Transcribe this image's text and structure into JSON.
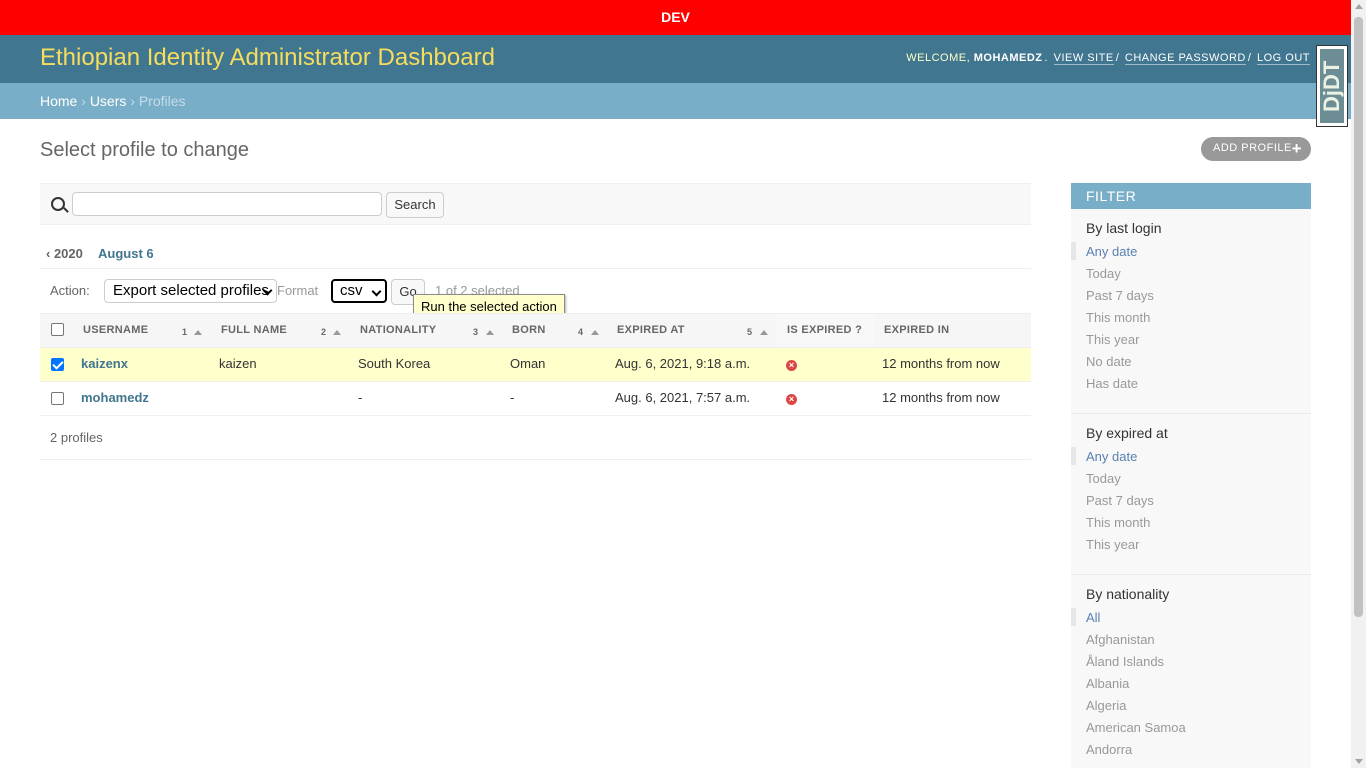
{
  "env_banner": "DEV",
  "header": {
    "title": "Ethiopian Identity Administrator Dashboard",
    "welcome": "Welcome,",
    "username": "mohamedz",
    "view_site": "View site",
    "change_password": "Change password",
    "log_out": "Log out"
  },
  "breadcrumbs": {
    "home": "Home",
    "users": "Users",
    "current": "Profiles"
  },
  "debug_toolbar": {
    "label": "DjDT"
  },
  "page": {
    "title": "Select profile to change",
    "add_button": "Add profile",
    "add_icon": "plus-icon"
  },
  "search": {
    "value": "",
    "placeholder": "",
    "button": "Search",
    "icon": "search-icon"
  },
  "date_hierarchy": {
    "back": "‹ 2020",
    "current": "August 6"
  },
  "actions": {
    "label": "Action:",
    "selected_action": "Export selected profiles",
    "format_label": "Format",
    "format_value": "csv",
    "go": "Go",
    "selection_count": "1 of 2 selected",
    "tooltip": "Run the selected action"
  },
  "table": {
    "columns": [
      {
        "label": "Username",
        "sort": "1"
      },
      {
        "label": "Full name",
        "sort": "2"
      },
      {
        "label": "Nationality",
        "sort": "3"
      },
      {
        "label": "Born",
        "sort": "4"
      },
      {
        "label": "Expired at",
        "sort": "5"
      },
      {
        "label": "Is expired ?",
        "sort": ""
      },
      {
        "label": "Expired in",
        "sort": ""
      }
    ],
    "rows": [
      {
        "selected": true,
        "username": "kaizenx",
        "full_name": "kaizen",
        "nationality": "South Korea",
        "born": "Oman",
        "expired_at": "Aug. 6, 2021, 9:18 a.m.",
        "is_expired": "×",
        "expired_in": "12 months from now"
      },
      {
        "selected": false,
        "username": "mohamedz",
        "full_name": "",
        "nationality": "-",
        "born": "-",
        "expired_at": "Aug. 6, 2021, 7:57 a.m.",
        "is_expired": "×",
        "expired_in": "12 months from now"
      }
    ],
    "count": "2 profiles"
  },
  "filter": {
    "title": "Filter",
    "groups": [
      {
        "title": "By last login",
        "items": [
          "Any date",
          "Today",
          "Past 7 days",
          "This month",
          "This year",
          "No date",
          "Has date"
        ]
      },
      {
        "title": "By expired at",
        "items": [
          "Any date",
          "Today",
          "Past 7 days",
          "This month",
          "This year"
        ]
      },
      {
        "title": "By nationality",
        "items": [
          "All",
          "Afghanistan",
          "Åland Islands",
          "Albania",
          "Algeria",
          "American Samoa",
          "Andorra"
        ]
      }
    ]
  },
  "colors": {
    "banner": "#ff0000",
    "header": "#417690",
    "breadcrumbs": "#79aec8",
    "branding": "#f5dd5d",
    "selected_row": "#ffffcc"
  }
}
